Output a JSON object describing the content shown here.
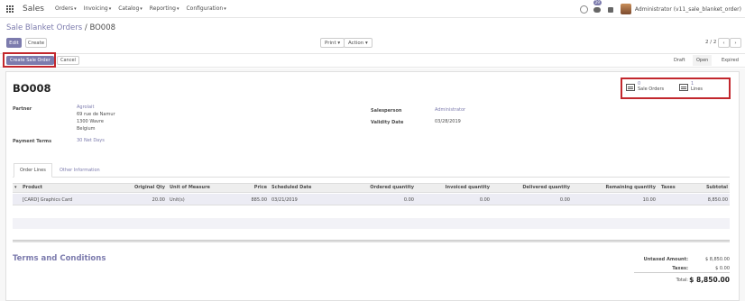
{
  "navbar": {
    "brand": "Sales",
    "menu": [
      {
        "label": "Orders"
      },
      {
        "label": "Invoicing"
      },
      {
        "label": "Catalog"
      },
      {
        "label": "Reporting"
      },
      {
        "label": "Configuration"
      }
    ],
    "chat_badge": "29",
    "user": "Administrator (v11_sale_blanket_order)"
  },
  "breadcrumb": {
    "parent": "Sale Blanket Orders",
    "separator": " / ",
    "current": "BO008"
  },
  "toolbar": {
    "edit": "Edit",
    "create": "Create",
    "print": "Print",
    "action": "Action",
    "pager": "2 / 2"
  },
  "statusbar": {
    "create_sale_order": "Create Sale Order",
    "cancel": "Cancel",
    "stages": [
      "Draft",
      "Open",
      "Expired"
    ],
    "active_stage": "Open"
  },
  "form": {
    "name": "BO008",
    "smart_buttons": {
      "sale_orders": {
        "value": "0",
        "label": "Sale Orders"
      },
      "lines": {
        "value": "1",
        "label": "Lines"
      }
    },
    "partner_label": "Partner",
    "partner_name": "Agrolait",
    "partner_address": [
      "69 rue de Namur",
      "1300 Wavre",
      "Belgium"
    ],
    "payment_terms_label": "Payment Terms",
    "payment_terms": "30 Net Days",
    "salesperson_label": "Salesperson",
    "salesperson": "Administrator",
    "validity_date_label": "Validity Date",
    "validity_date": "03/28/2019"
  },
  "tabs": {
    "order_lines": "Order Lines",
    "other_info": "Other Information"
  },
  "table": {
    "headers": {
      "product": "Product",
      "original_qty": "Original Qty",
      "uom": "Unit of Measure",
      "price": "Price",
      "scheduled_date": "Scheduled Date",
      "ordered_qty": "Ordered quantity",
      "invoiced_qty": "Invoiced quantity",
      "delivered_qty": "Delivered quantity",
      "remaining_qty": "Remaining quantity",
      "taxes": "Taxes",
      "subtotal": "Subtotal"
    },
    "rows": [
      {
        "product": "[CARD] Graphics Card",
        "original_qty": "20.00",
        "uom": "Unit(s)",
        "price": "885.00",
        "scheduled_date": "03/21/2019",
        "ordered_qty": "0.00",
        "invoiced_qty": "0.00",
        "delivered_qty": "0.00",
        "remaining_qty": "10.00",
        "taxes": "",
        "subtotal": "8,850.00"
      }
    ]
  },
  "terms_title": "Terms and Conditions",
  "totals": {
    "untaxed_label": "Untaxed Amount:",
    "untaxed_value": "$ 8,850.00",
    "taxes_label": "Taxes:",
    "taxes_value": "$ 0.00",
    "total_label": "Total:",
    "total_value": "$ 8,850.00"
  },
  "colors": {
    "brand": "#7c7bad",
    "highlight": "#c2272d"
  }
}
